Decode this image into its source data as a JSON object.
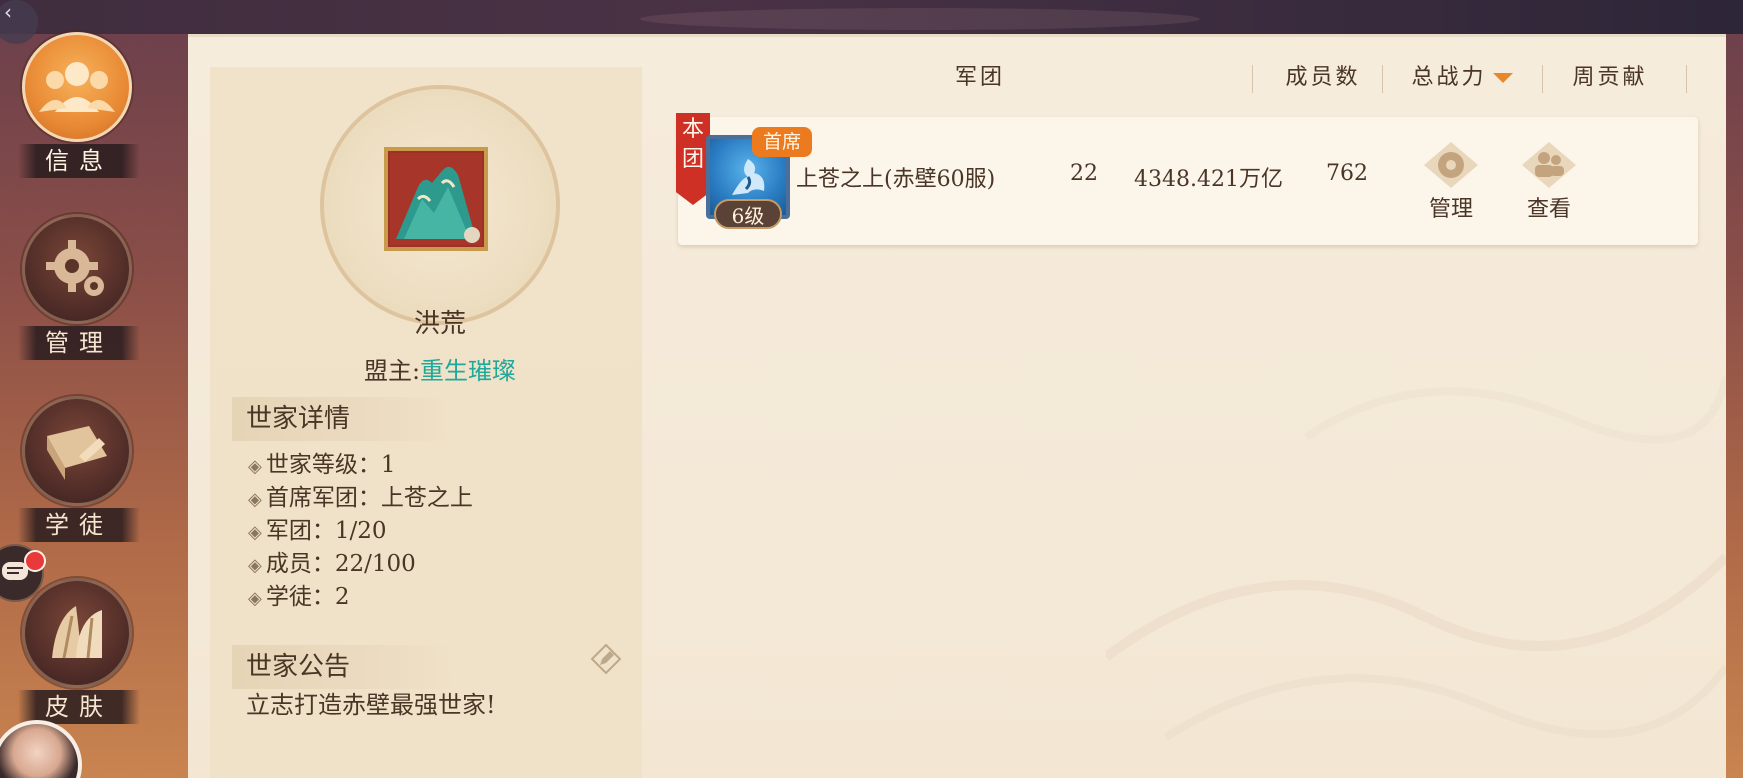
{
  "header": {
    "back_glyph": "‹"
  },
  "side_nav": {
    "items": [
      {
        "label": "信息",
        "icon": "members-icon",
        "active": true
      },
      {
        "label": "管理",
        "icon": "gear-icon",
        "active": false
      },
      {
        "label": "学徒",
        "icon": "scroll-icon",
        "active": false
      },
      {
        "label": "皮肤",
        "icon": "fan-icon",
        "active": false
      }
    ]
  },
  "clan": {
    "name": "洪荒",
    "leader_label": "盟主:",
    "leader_name": "重生璀璨"
  },
  "details": {
    "title": "世家详情",
    "rows": [
      {
        "text": "世家等级：1"
      },
      {
        "text": "首席军团：上苍之上"
      },
      {
        "text": "军团：1/20"
      },
      {
        "text": "成员：22/100"
      },
      {
        "text": "学徒：2"
      }
    ],
    "bullet": "◈"
  },
  "notice": {
    "title": "世家公告",
    "text": "立志打造赤壁最强世家!"
  },
  "table": {
    "headers": {
      "legion": "军团",
      "members": "成员数",
      "power": "总战力",
      "weekly": "周贡献"
    },
    "rows": [
      {
        "own_tag": "本团",
        "chief_badge": "首席",
        "level": "6级",
        "name": "上苍之上(赤壁60服)",
        "members": "22",
        "power": "4348.421万亿",
        "weekly": "762",
        "manage_label": "管理",
        "view_label": "查看"
      }
    ]
  },
  "colors": {
    "accent_orange": "#e8882c",
    "leader_teal": "#20a89a",
    "tag_red": "#cf3025"
  }
}
